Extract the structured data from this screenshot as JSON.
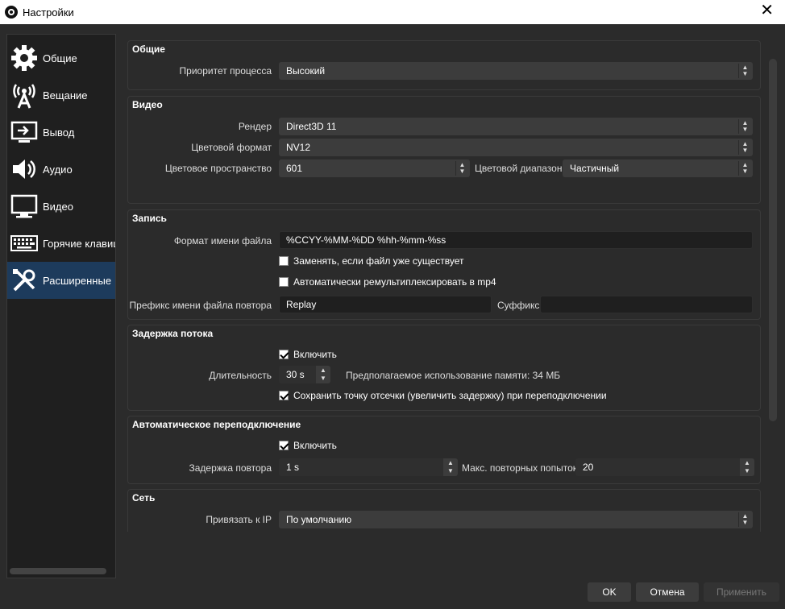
{
  "window": {
    "title": "Настройки"
  },
  "sidebar": {
    "items": [
      {
        "label": "Общие",
        "icon": "gear-icon"
      },
      {
        "label": "Вещание",
        "icon": "broadcast-antenna-icon"
      },
      {
        "label": "Вывод",
        "icon": "output-monitor-icon"
      },
      {
        "label": "Аудио",
        "icon": "speaker-icon"
      },
      {
        "label": "Видео",
        "icon": "monitor-icon"
      },
      {
        "label": "Горячие клавиши",
        "icon": "keyboard-icon"
      },
      {
        "label": "Расширенные",
        "icon": "tools-icon",
        "active": true
      }
    ]
  },
  "general": {
    "title": "Общие",
    "priority_label": "Приоритет процесса",
    "priority_value": "Высокий"
  },
  "video": {
    "title": "Видео",
    "renderer_label": "Рендер",
    "renderer_value": "Direct3D 11",
    "color_format_label": "Цветовой формат",
    "color_format_value": "NV12",
    "color_space_label": "Цветовое пространство",
    "color_space_value": "601",
    "color_range_label": "Цветовой диапазон",
    "color_range_value": "Частичный"
  },
  "recording": {
    "title": "Запись",
    "filename_format_label": "Формат имени файла",
    "filename_format_value": "%CCYY-%MM-%DD %hh-%mm-%ss",
    "overwrite_label": "Заменять, если файл уже существует",
    "overwrite_checked": false,
    "remux_label": "Автоматически ремультиплексировать в mp4",
    "remux_checked": false,
    "replay_prefix_label": "Префикс имени файла повтора",
    "replay_prefix_value": "Replay",
    "suffix_label": "Суффикс",
    "suffix_value": ""
  },
  "stream_delay": {
    "title": "Задержка потока",
    "enable_label": "Включить",
    "enable_checked": true,
    "duration_label": "Длительность",
    "duration_value": "30 s",
    "memory_note": "Предполагаемое использование памяти: 34 МБ",
    "preserve_label": "Сохранить точку отсечки (увеличить задержку) при переподключении",
    "preserve_checked": true
  },
  "reconnect": {
    "title": "Автоматическое переподключение",
    "enable_label": "Включить",
    "enable_checked": true,
    "retry_delay_label": "Задержка повтора",
    "retry_delay_value": "1 s",
    "max_retries_label": "Макс. повторных попыток",
    "max_retries_value": "20"
  },
  "network": {
    "title": "Сеть",
    "bind_ip_label": "Привязать к IP",
    "bind_ip_value": "По умолчанию"
  },
  "footer": {
    "ok_label": "OK",
    "cancel_label": "Отмена",
    "apply_label": "Применить"
  },
  "colors": {
    "background": "#2b2b2b",
    "sidebar_background": "#1f1f1f",
    "active_item": "#1d3b5c",
    "input_background": "#1f1f1f",
    "combo_background": "#3c3c3c"
  }
}
